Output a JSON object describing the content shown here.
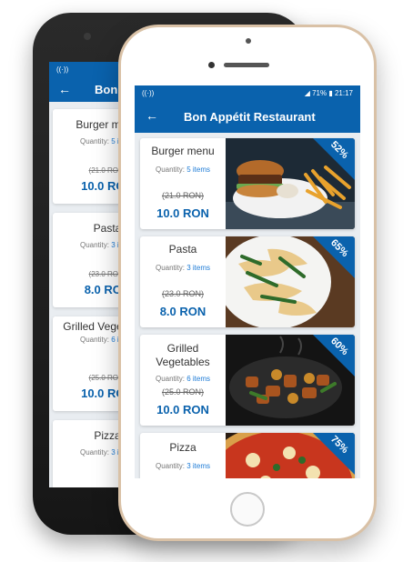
{
  "app": {
    "title": "Bon Appétit Restaurant",
    "back_title_partial": "Bon",
    "accent": "#0a62ad"
  },
  "statusbar": {
    "signal_icon": "wifi-signal-icon",
    "battery": "71%",
    "time": "21:17"
  },
  "quantity_label": "Quantity:",
  "items": [
    {
      "name": "Burger menu",
      "quantity": "5 items",
      "old_price": "(21.0 RON)",
      "price": "10.0 RON",
      "discount": "52%"
    },
    {
      "name": "Pasta",
      "quantity": "3 items",
      "old_price": "(23.0 RON)",
      "price": "8.0 RON",
      "discount": "65%"
    },
    {
      "name": "Grilled Vegetables",
      "quantity": "6 items",
      "old_price": "(25.0 RON)",
      "price": "10.0 RON",
      "discount": "60%"
    },
    {
      "name": "Pizza",
      "quantity": "3 items",
      "old_price": "",
      "price": "",
      "discount": "75%"
    }
  ],
  "back_items": [
    {
      "name": "Burger menu",
      "quantity": "5 items",
      "old_price": "(21.0 RON)",
      "price": "10.0 RON"
    },
    {
      "name": "Pasta",
      "quantity": "3 items",
      "old_price": "(23.0 RON)",
      "price": "8.0 RON"
    },
    {
      "name": "Grilled Vegetables",
      "quantity": "6 items",
      "old_price": "(25.0 RON)",
      "price": "10.0 RON"
    },
    {
      "name": "Pizza",
      "quantity": "3 items",
      "old_price": "",
      "price": ""
    }
  ]
}
